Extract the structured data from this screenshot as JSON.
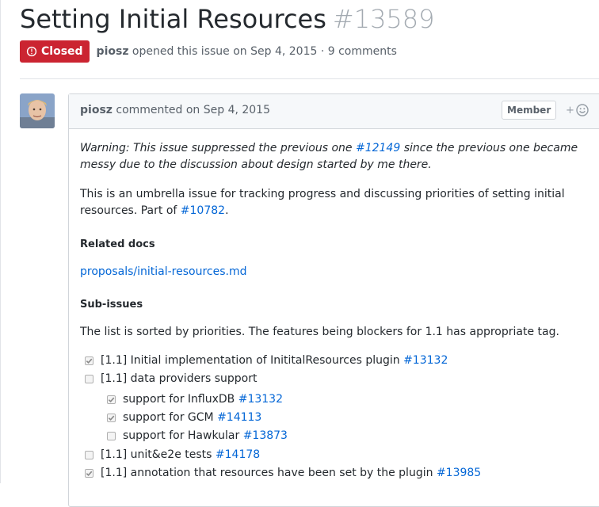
{
  "issue": {
    "title": "Setting Initial Resources",
    "number": "#13589",
    "state": "Closed",
    "author": "piosz",
    "meta_text": "opened this issue on Sep 4, 2015 · 9 comments"
  },
  "comment": {
    "author": "piosz",
    "action": "commented on Sep 4, 2015",
    "role_badge": "Member",
    "reaction_button": "+",
    "warning_prefix": "Warning: This issue suppressed the previous one ",
    "warning_link": "#12149",
    "warning_suffix": " since the previous one became messy due to the discussion about design started by me there.",
    "umbrella_prefix": "This is an umbrella issue for tracking progress and discussing priorities of setting initial resources. Part of ",
    "umbrella_link": "#10782",
    "umbrella_suffix": ".",
    "related_docs_heading": "Related docs",
    "related_docs_link": "proposals/initial-resources.md",
    "sub_issues_heading": "Sub-issues",
    "sorted_text": "The list is sorted by priorities. The features being blockers for 1.1 has appropriate tag.",
    "tasks": [
      {
        "checked": true,
        "text": "[1.1] Initial implementation of InititalResources plugin ",
        "link": "#13132"
      },
      {
        "checked": false,
        "text": "[1.1] data providers support",
        "link": ""
      },
      {
        "checked": true,
        "text": "support for InfluxDB ",
        "link": "#13132"
      },
      {
        "checked": true,
        "text": "support for GCM ",
        "link": "#14113"
      },
      {
        "checked": false,
        "text": "support for Hawkular ",
        "link": "#13873"
      },
      {
        "checked": false,
        "text": "[1.1] unit&e2e tests ",
        "link": "#14178"
      },
      {
        "checked": true,
        "text": "[1.1] annotation that resources have been set by the plugin ",
        "link": "#13985"
      }
    ]
  },
  "colors": {
    "closed_badge": "#cb2431",
    "link": "#0366d6"
  }
}
